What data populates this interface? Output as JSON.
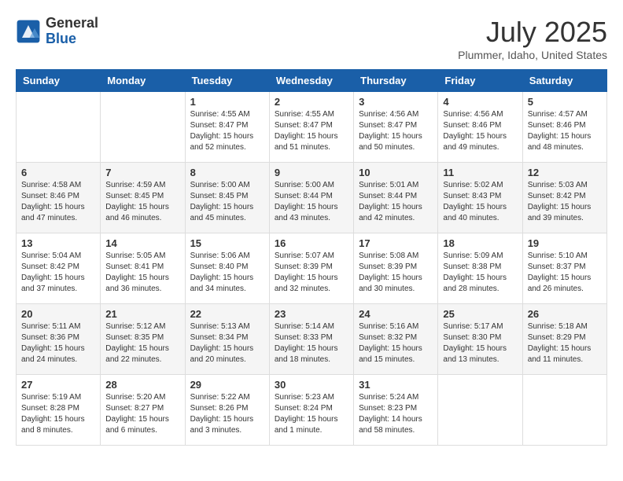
{
  "header": {
    "logo_general": "General",
    "logo_blue": "Blue",
    "month_year": "July 2025",
    "location": "Plummer, Idaho, United States"
  },
  "weekdays": [
    "Sunday",
    "Monday",
    "Tuesday",
    "Wednesday",
    "Thursday",
    "Friday",
    "Saturday"
  ],
  "weeks": [
    [
      {
        "day": "",
        "detail": ""
      },
      {
        "day": "",
        "detail": ""
      },
      {
        "day": "1",
        "detail": "Sunrise: 4:55 AM\nSunset: 8:47 PM\nDaylight: 15 hours\nand 52 minutes."
      },
      {
        "day": "2",
        "detail": "Sunrise: 4:55 AM\nSunset: 8:47 PM\nDaylight: 15 hours\nand 51 minutes."
      },
      {
        "day": "3",
        "detail": "Sunrise: 4:56 AM\nSunset: 8:47 PM\nDaylight: 15 hours\nand 50 minutes."
      },
      {
        "day": "4",
        "detail": "Sunrise: 4:56 AM\nSunset: 8:46 PM\nDaylight: 15 hours\nand 49 minutes."
      },
      {
        "day": "5",
        "detail": "Sunrise: 4:57 AM\nSunset: 8:46 PM\nDaylight: 15 hours\nand 48 minutes."
      }
    ],
    [
      {
        "day": "6",
        "detail": "Sunrise: 4:58 AM\nSunset: 8:46 PM\nDaylight: 15 hours\nand 47 minutes."
      },
      {
        "day": "7",
        "detail": "Sunrise: 4:59 AM\nSunset: 8:45 PM\nDaylight: 15 hours\nand 46 minutes."
      },
      {
        "day": "8",
        "detail": "Sunrise: 5:00 AM\nSunset: 8:45 PM\nDaylight: 15 hours\nand 45 minutes."
      },
      {
        "day": "9",
        "detail": "Sunrise: 5:00 AM\nSunset: 8:44 PM\nDaylight: 15 hours\nand 43 minutes."
      },
      {
        "day": "10",
        "detail": "Sunrise: 5:01 AM\nSunset: 8:44 PM\nDaylight: 15 hours\nand 42 minutes."
      },
      {
        "day": "11",
        "detail": "Sunrise: 5:02 AM\nSunset: 8:43 PM\nDaylight: 15 hours\nand 40 minutes."
      },
      {
        "day": "12",
        "detail": "Sunrise: 5:03 AM\nSunset: 8:42 PM\nDaylight: 15 hours\nand 39 minutes."
      }
    ],
    [
      {
        "day": "13",
        "detail": "Sunrise: 5:04 AM\nSunset: 8:42 PM\nDaylight: 15 hours\nand 37 minutes."
      },
      {
        "day": "14",
        "detail": "Sunrise: 5:05 AM\nSunset: 8:41 PM\nDaylight: 15 hours\nand 36 minutes."
      },
      {
        "day": "15",
        "detail": "Sunrise: 5:06 AM\nSunset: 8:40 PM\nDaylight: 15 hours\nand 34 minutes."
      },
      {
        "day": "16",
        "detail": "Sunrise: 5:07 AM\nSunset: 8:39 PM\nDaylight: 15 hours\nand 32 minutes."
      },
      {
        "day": "17",
        "detail": "Sunrise: 5:08 AM\nSunset: 8:39 PM\nDaylight: 15 hours\nand 30 minutes."
      },
      {
        "day": "18",
        "detail": "Sunrise: 5:09 AM\nSunset: 8:38 PM\nDaylight: 15 hours\nand 28 minutes."
      },
      {
        "day": "19",
        "detail": "Sunrise: 5:10 AM\nSunset: 8:37 PM\nDaylight: 15 hours\nand 26 minutes."
      }
    ],
    [
      {
        "day": "20",
        "detail": "Sunrise: 5:11 AM\nSunset: 8:36 PM\nDaylight: 15 hours\nand 24 minutes."
      },
      {
        "day": "21",
        "detail": "Sunrise: 5:12 AM\nSunset: 8:35 PM\nDaylight: 15 hours\nand 22 minutes."
      },
      {
        "day": "22",
        "detail": "Sunrise: 5:13 AM\nSunset: 8:34 PM\nDaylight: 15 hours\nand 20 minutes."
      },
      {
        "day": "23",
        "detail": "Sunrise: 5:14 AM\nSunset: 8:33 PM\nDaylight: 15 hours\nand 18 minutes."
      },
      {
        "day": "24",
        "detail": "Sunrise: 5:16 AM\nSunset: 8:32 PM\nDaylight: 15 hours\nand 15 minutes."
      },
      {
        "day": "25",
        "detail": "Sunrise: 5:17 AM\nSunset: 8:30 PM\nDaylight: 15 hours\nand 13 minutes."
      },
      {
        "day": "26",
        "detail": "Sunrise: 5:18 AM\nSunset: 8:29 PM\nDaylight: 15 hours\nand 11 minutes."
      }
    ],
    [
      {
        "day": "27",
        "detail": "Sunrise: 5:19 AM\nSunset: 8:28 PM\nDaylight: 15 hours\nand 8 minutes."
      },
      {
        "day": "28",
        "detail": "Sunrise: 5:20 AM\nSunset: 8:27 PM\nDaylight: 15 hours\nand 6 minutes."
      },
      {
        "day": "29",
        "detail": "Sunrise: 5:22 AM\nSunset: 8:26 PM\nDaylight: 15 hours\nand 3 minutes."
      },
      {
        "day": "30",
        "detail": "Sunrise: 5:23 AM\nSunset: 8:24 PM\nDaylight: 15 hours\nand 1 minute."
      },
      {
        "day": "31",
        "detail": "Sunrise: 5:24 AM\nSunset: 8:23 PM\nDaylight: 14 hours\nand 58 minutes."
      },
      {
        "day": "",
        "detail": ""
      },
      {
        "day": "",
        "detail": ""
      }
    ]
  ]
}
